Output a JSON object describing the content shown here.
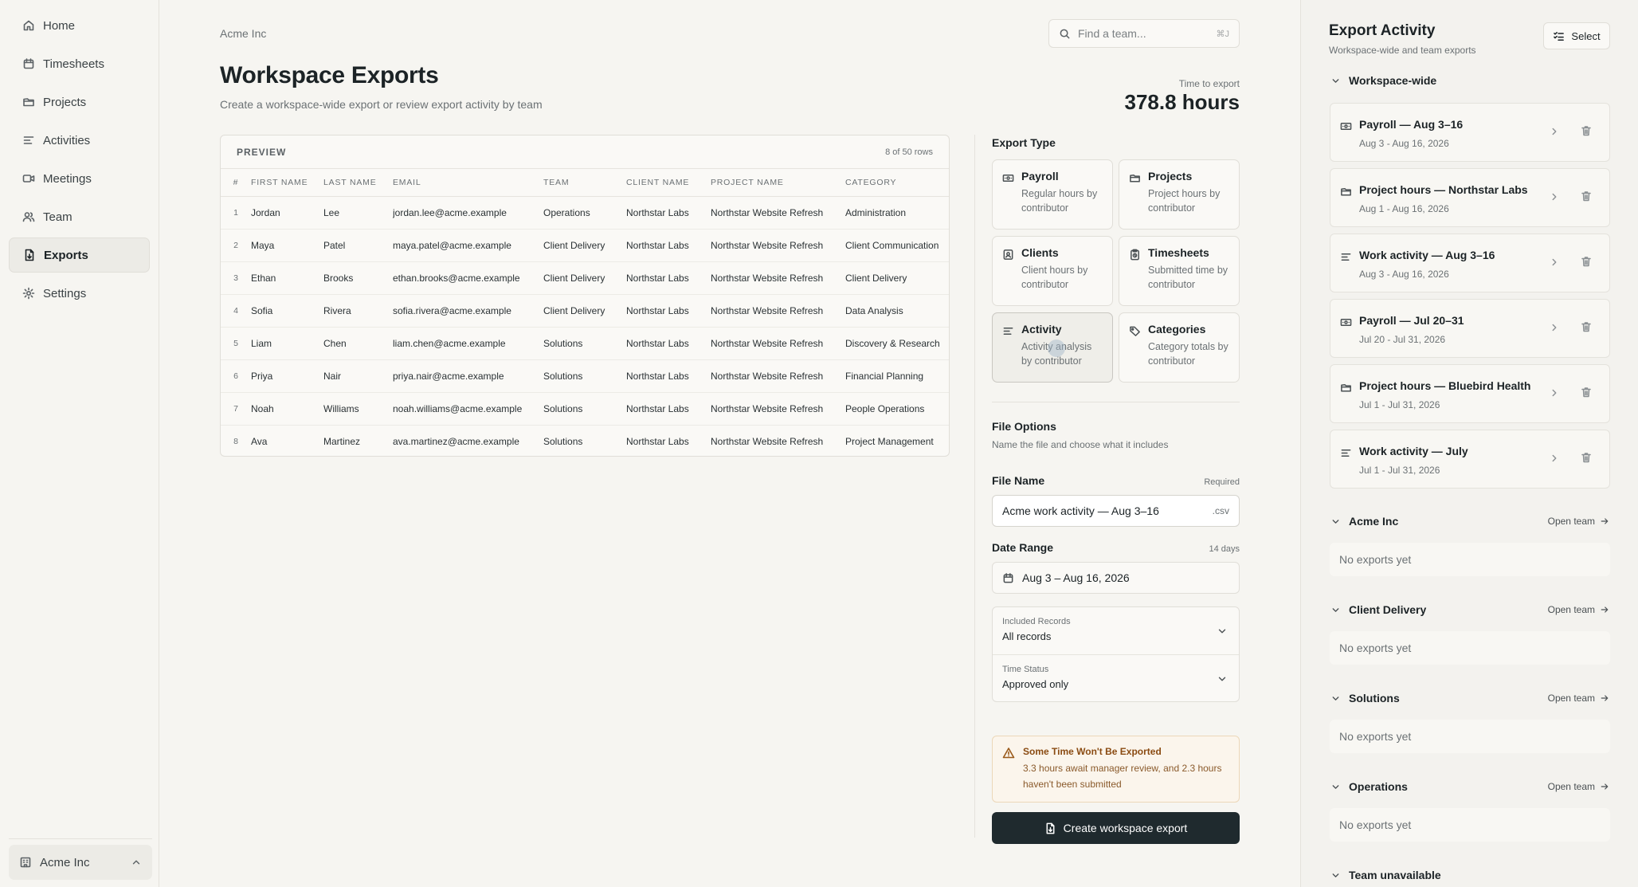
{
  "sidebar": {
    "items": [
      {
        "label": "Home",
        "icon": "home-icon"
      },
      {
        "label": "Timesheets",
        "icon": "calendar-icon"
      },
      {
        "label": "Projects",
        "icon": "folder-icon"
      },
      {
        "label": "Activities",
        "icon": "activity-lines-icon"
      },
      {
        "label": "Meetings",
        "icon": "video-icon"
      },
      {
        "label": "Team",
        "icon": "users-icon"
      },
      {
        "label": "Exports",
        "icon": "file-export-icon",
        "active": true
      },
      {
        "label": "Settings",
        "icon": "gear-icon"
      }
    ],
    "workspace": "Acme Inc"
  },
  "header": {
    "breadcrumb": "Acme Inc",
    "search_placeholder": "Find a team...",
    "search_shortcut": "⌘J",
    "title": "Workspace Exports",
    "subtitle": "Create a workspace-wide export or review export activity by team",
    "time_to_export_label": "Time to export",
    "time_to_export_value": "378.8 hours"
  },
  "preview": {
    "title": "PREVIEW",
    "rows_count": "8 of 50 rows",
    "columns": [
      "#",
      "FIRST NAME",
      "LAST NAME",
      "EMAIL",
      "TEAM",
      "CLIENT NAME",
      "PROJECT NAME",
      "CATEGORY"
    ],
    "rows": [
      [
        "1",
        "Jordan",
        "Lee",
        "jordan.lee@acme.example",
        "Operations",
        "Northstar Labs",
        "Northstar Website Refresh",
        "Administration"
      ],
      [
        "2",
        "Maya",
        "Patel",
        "maya.patel@acme.example",
        "Client Delivery",
        "Northstar Labs",
        "Northstar Website Refresh",
        "Client Communication"
      ],
      [
        "3",
        "Ethan",
        "Brooks",
        "ethan.brooks@acme.example",
        "Client Delivery",
        "Northstar Labs",
        "Northstar Website Refresh",
        "Client Delivery"
      ],
      [
        "4",
        "Sofia",
        "Rivera",
        "sofia.rivera@acme.example",
        "Client Delivery",
        "Northstar Labs",
        "Northstar Website Refresh",
        "Data Analysis"
      ],
      [
        "5",
        "Liam",
        "Chen",
        "liam.chen@acme.example",
        "Solutions",
        "Northstar Labs",
        "Northstar Website Refresh",
        "Discovery & Research"
      ],
      [
        "6",
        "Priya",
        "Nair",
        "priya.nair@acme.example",
        "Solutions",
        "Northstar Labs",
        "Northstar Website Refresh",
        "Financial Planning"
      ],
      [
        "7",
        "Noah",
        "Williams",
        "noah.williams@acme.example",
        "Solutions",
        "Northstar Labs",
        "Northstar Website Refresh",
        "People Operations"
      ],
      [
        "8",
        "Ava",
        "Martinez",
        "ava.martinez@acme.example",
        "Solutions",
        "Northstar Labs",
        "Northstar Website Refresh",
        "Project Management"
      ]
    ]
  },
  "export_panel": {
    "export_type_title": "Export Type",
    "types": [
      {
        "title": "Payroll",
        "desc": "Regular hours by contributor",
        "icon": "money-icon"
      },
      {
        "title": "Projects",
        "desc": "Project hours by contributor",
        "icon": "folder-icon"
      },
      {
        "title": "Clients",
        "desc": "Client hours by contributor",
        "icon": "client-badge-icon"
      },
      {
        "title": "Timesheets",
        "desc": "Submitted time by contributor",
        "icon": "clipboard-icon"
      },
      {
        "title": "Activity",
        "desc": "Activity analysis by contributor",
        "icon": "activity-lines-icon",
        "selected": true
      },
      {
        "title": "Categories",
        "desc": "Category totals by contributor",
        "icon": "tag-icon"
      }
    ],
    "file_options_title": "File Options",
    "file_options_sub": "Name the file and choose what it includes",
    "file_name_label": "File Name",
    "file_name_required": "Required",
    "file_name_value": "Acme work activity — Aug 3–16",
    "file_ext": ".csv",
    "date_range_label": "Date Range",
    "date_range_days": "14 days",
    "date_range_value": "Aug 3 – Aug 16, 2026",
    "included_records_label": "Included Records",
    "included_records_value": "All records",
    "time_status_label": "Time Status",
    "time_status_value": "Approved only",
    "warning_title": "Some Time Won't Be Exported",
    "warning_text": "3.3 hours await manager review, and 2.3 hours haven't been submitted",
    "create_button": "Create workspace export"
  },
  "activity": {
    "title": "Export Activity",
    "subtitle": "Workspace-wide and team exports",
    "select_button": "Select",
    "workspace_group": "Workspace-wide",
    "exports": [
      {
        "name": "Payroll — Aug 3–16",
        "range": "Aug 3 - Aug 16, 2026",
        "icon": "money-icon"
      },
      {
        "name": "Project hours — Northstar Labs",
        "range": "Aug 1 - Aug 16, 2026",
        "icon": "folder-icon"
      },
      {
        "name": "Work activity — Aug 3–16",
        "range": "Aug 3 - Aug 16, 2026",
        "icon": "activity-lines-icon"
      },
      {
        "name": "Payroll — Jul 20–31",
        "range": "Jul 20 - Jul 31, 2026",
        "icon": "money-icon"
      },
      {
        "name": "Project hours — Bluebird Health",
        "range": "Jul 1 - Jul 31, 2026",
        "icon": "folder-icon"
      },
      {
        "name": "Work activity — July",
        "range": "Jul 1 - Jul 31, 2026",
        "icon": "activity-lines-icon"
      }
    ],
    "teams": [
      {
        "name": "Acme Inc",
        "open": "Open team",
        "empty": "No exports yet"
      },
      {
        "name": "Client Delivery",
        "open": "Open team",
        "empty": "No exports yet"
      },
      {
        "name": "Solutions",
        "open": "Open team",
        "empty": "No exports yet"
      },
      {
        "name": "Operations",
        "open": "Open team",
        "empty": "No exports yet"
      }
    ],
    "unavailable_group": "Team unavailable"
  }
}
